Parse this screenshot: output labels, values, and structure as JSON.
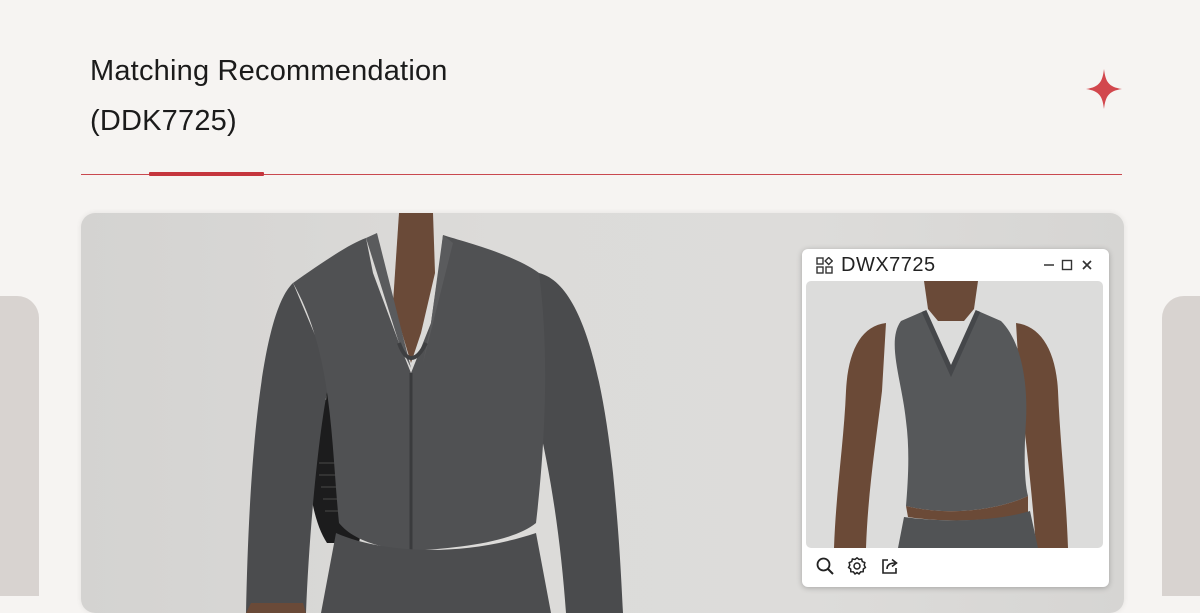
{
  "page": {
    "title_line1": "Matching Recommendation",
    "title_line2": "(DDK7725)",
    "accent_color": "#c5353d",
    "background_color": "#f6f4f2"
  },
  "hero": {
    "image": "model wearing dark gray zip-up long sleeve jacket with black shoulder bag"
  },
  "popup": {
    "title": "DWX7725",
    "image": "model wearing dark gray halter tank top",
    "header_icons": [
      "grid-icon",
      "minimize-icon",
      "maximize-icon",
      "close-icon"
    ],
    "toolbar_icons": [
      "zoom-icon",
      "settings-icon",
      "share-icon"
    ]
  }
}
